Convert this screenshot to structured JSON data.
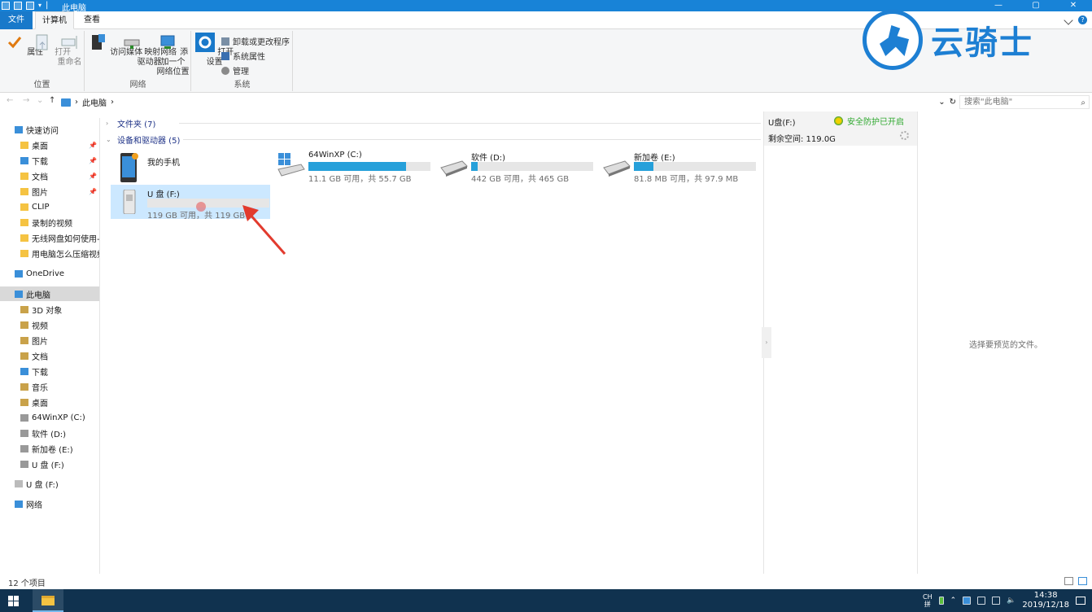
{
  "window": {
    "title": "此电脑",
    "min": "—",
    "max": "▢",
    "close": "✕"
  },
  "ribbon_tabs": {
    "file": "文件",
    "computer": "计算机",
    "view": "查看"
  },
  "ribbon": {
    "location": {
      "label": "位置",
      "properties": "属性",
      "open": "打开",
      "rename": "重命名"
    },
    "network": {
      "label": "网络",
      "access_media": "访问媒体",
      "map_drive_1": "映射网络",
      "map_drive_2": "驱动器",
      "add_location_1": "添加一个",
      "add_location_2": "网络位置"
    },
    "system": {
      "label": "系统",
      "open_settings_1": "打开",
      "open_settings_2": "设置",
      "uninstall": "卸载或更改程序",
      "sys_props": "系统属性",
      "manage": "管理"
    }
  },
  "address": {
    "back": "←",
    "forward": "→",
    "recent": "⌄",
    "up": "↑",
    "crumb": "此电脑",
    "sep": "›",
    "dropdown": "⌄",
    "refresh": "↻",
    "search_placeholder": "搜索\"此电脑\"",
    "search_icon": "⌕"
  },
  "nav": {
    "quick_access": "快速访问",
    "items": [
      {
        "label": "桌面",
        "pinned": true
      },
      {
        "label": "下载",
        "pinned": true
      },
      {
        "label": "文档",
        "pinned": true
      },
      {
        "label": "图片",
        "pinned": true
      },
      {
        "label": "CLIP",
        "pinned": false
      },
      {
        "label": "录制的视频",
        "pinned": false
      },
      {
        "label": "无线网盘如何使用---",
        "pinned": false
      },
      {
        "label": "用电脑怎么压缩视频",
        "pinned": false
      }
    ],
    "onedrive": "OneDrive",
    "this_pc": "此电脑",
    "pc_items": [
      "3D 对象",
      "视频",
      "图片",
      "文档",
      "下载",
      "音乐",
      "桌面",
      "64WinXP  (C:)",
      "软件 (D:)",
      "新加卷 (E:)",
      "U 盘 (F:)"
    ],
    "usb": "U 盘 (F:)",
    "network": "网络",
    "pin_glyph": "📌"
  },
  "content": {
    "folders_header": "文件夹 (7)",
    "devices_header": "设备和驱动器 (5)",
    "drives": [
      {
        "name": "我的手机",
        "info": "",
        "used": 0,
        "icon": "phone-icon"
      },
      {
        "name": "64WinXP  (C:)",
        "info": "11.1 GB 可用，共 55.7 GB",
        "used": 0.8,
        "icon": "windows-drive-icon"
      },
      {
        "name": "软件 (D:)",
        "info": "442 GB 可用，共 465 GB",
        "used": 0.05,
        "icon": "hard-drive-icon"
      },
      {
        "name": "新加卷 (E:)",
        "info": "81.8 MB 可用，共 97.9 MB",
        "used": 0.16,
        "icon": "hard-drive-icon"
      },
      {
        "name": "U 盘 (F:)",
        "info": "119 GB 可用，共 119 GB",
        "used": 0.0,
        "icon": "usb-drive-icon"
      }
    ]
  },
  "details": {
    "title": "U盘(F:)",
    "protection": "安全防护已开启",
    "free_space": "剩余空间: 119.0G",
    "preview_msg": "选择要预览的文件。"
  },
  "status": {
    "count": "12 个项目"
  },
  "taskbar": {
    "ime_1": "CH",
    "ime_2": "拼",
    "time": "14:38",
    "date": "2019/12/18"
  },
  "watermark": {
    "text": "云骑士"
  },
  "colors": {
    "accent": "#1883d7",
    "selection": "#cce8ff",
    "bar_fill": "#26a0da",
    "safe_green": "#2fa82f"
  }
}
